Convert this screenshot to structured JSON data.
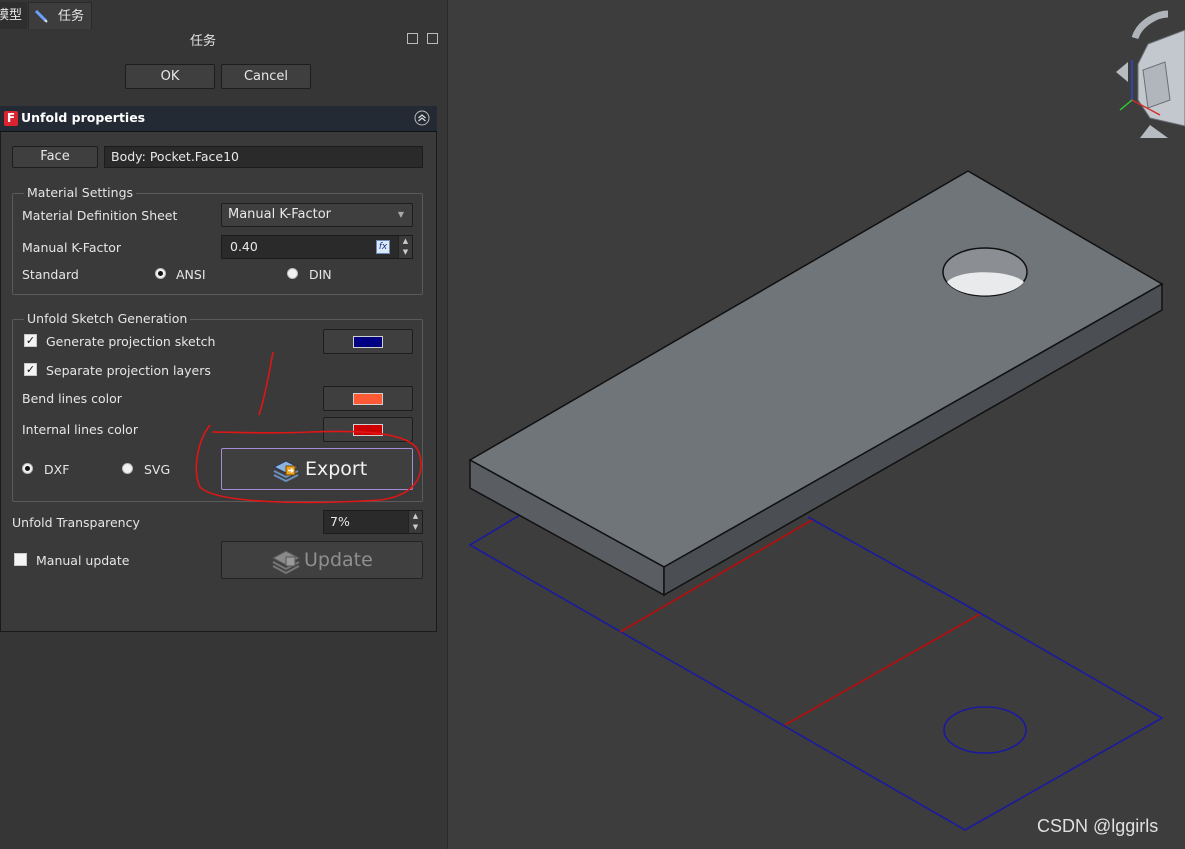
{
  "tabs": [
    {
      "label": "模型"
    },
    {
      "label": "任务"
    }
  ],
  "panel_title": "任务",
  "dialog": {
    "ok_label": "OK",
    "cancel_label": "Cancel"
  },
  "unfold": {
    "title": "Unfold properties",
    "face_button": "Face",
    "face_value": "Body: Pocket.Face10",
    "material": {
      "legend": "Material Settings",
      "definition_label": "Material Definition Sheet",
      "definition_value": "Manual K-Factor",
      "kfactor_label": "Manual K-Factor",
      "kfactor_value": "0.40",
      "standard_label": "Standard",
      "standard_options": [
        "ANSI",
        "DIN"
      ],
      "standard_selected": "ANSI"
    },
    "sketch": {
      "legend": "Unfold Sketch Generation",
      "gen_projection_label": "Generate projection sketch",
      "gen_projection_checked": true,
      "gen_projection_color": "#000080",
      "separate_layers_label": "Separate projection layers",
      "separate_layers_checked": true,
      "bend_color_label": "Bend lines color",
      "bend_color": "#ff5a36",
      "internal_color_label": "Internal lines color",
      "internal_color": "#cc0000",
      "format_options": [
        "DXF",
        "SVG"
      ],
      "format_selected": "DXF",
      "export_label": "Export"
    },
    "transparency_label": "Unfold Transparency",
    "transparency_value": "7%",
    "manual_update_label": "Manual update",
    "manual_update_checked": false,
    "update_label": "Update"
  },
  "watermark": "CSDN @lggirls",
  "colors": {
    "model_face": "#6e7378",
    "projection_outline": "#1a1aa0",
    "bend_line": "#b01010",
    "annotation": "#dd1111"
  }
}
